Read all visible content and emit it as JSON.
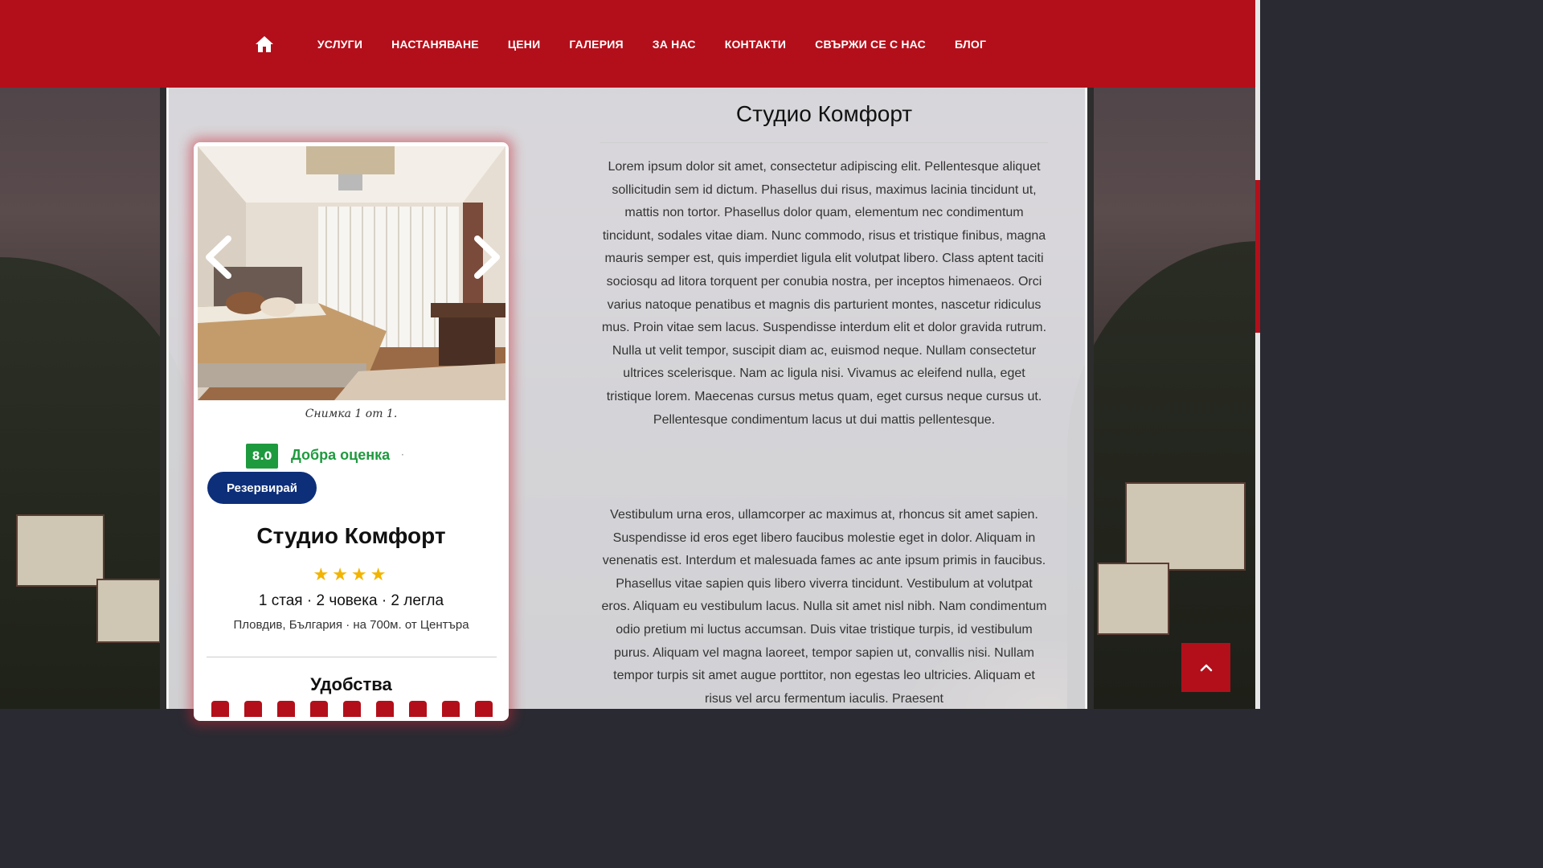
{
  "nav": {
    "home_icon": "home-icon",
    "items": [
      "УСЛУГИ",
      "НАСТАНЯВАНЕ",
      "ЦЕНИ",
      "ГАЛЕРИЯ",
      "ЗА НАС",
      "КОНТАКТИ",
      "СВЪРЖИ СЕ С НАС",
      "БЛОГ"
    ]
  },
  "card": {
    "caption": "Снимка 1 от 1.",
    "score": "8.0",
    "score_label": "Добра оценка",
    "score_dot": "·",
    "book_label": "Резервирай",
    "title": "Студио Комфорт",
    "stars": "★★★★",
    "rooms": "1 стая · 2 човека · 2 легла",
    "location": "Пловдив, България · на 700м. от Центъра",
    "amenities_title": "Удобства"
  },
  "article": {
    "title": "Студио Комфорт",
    "p1": "Lorem ipsum dolor sit amet, consectetur adipiscing elit. Pellentesque aliquet sollicitudin sem id dictum. Phasellus dui risus, maximus lacinia tincidunt ut, mattis non tortor. Phasellus dolor quam, elementum nec condimentum tincidunt, sodales vitae diam. Nunc commodo, risus et tristique finibus, magna mauris semper est, quis imperdiet ligula elit volutpat libero. Class aptent taciti sociosqu ad litora torquent per conubia nostra, per inceptos himenaeos. Orci varius natoque penatibus et magnis dis parturient montes, nascetur ridiculus mus. Proin vitae sem lacus. Suspendisse interdum elit et dolor gravida rutrum. Nulla ut velit tempor, suscipit diam ac, euismod neque. Nullam consectetur ultrices scelerisque. Nam ac ligula nisi. Vivamus ac eleifend nulla, eget tristique lorem. Maecenas cursus metus quam, eget cursus neque cursus ut. Pellentesque condimentum lacus ut dui mattis pellentesque.",
    "p2": "Vestibulum urna eros, ullamcorper ac maximus at, rhoncus sit amet sapien. Suspendisse id eros eget libero faucibus molestie eget in dolor. Aliquam in venenatis est. Interdum et malesuada fames ac ante ipsum primis in faucibus. Phasellus vitae sapien quis libero viverra tincidunt. Vestibulum at volutpat eros. Aliquam eu vestibulum lacus. Nulla sit amet nisl nibh. Nam condimentum odio pretium mi luctus accumsan. Duis vitae tristique turpis, id vestibulum purus. Aliquam vel magna laoreet, tempor sapien ut, convallis nisi. Nullam tempor turpis sit amet augue porttitor, non egestas leo ultricies. Aliquam et risus vel arcu fermentum iaculis. Praesent"
  },
  "colors": {
    "brand_red": "#b30f1a",
    "score_green": "#1e9a3e",
    "button_blue": "#0d2f7a",
    "star_yellow": "#f2b400"
  }
}
